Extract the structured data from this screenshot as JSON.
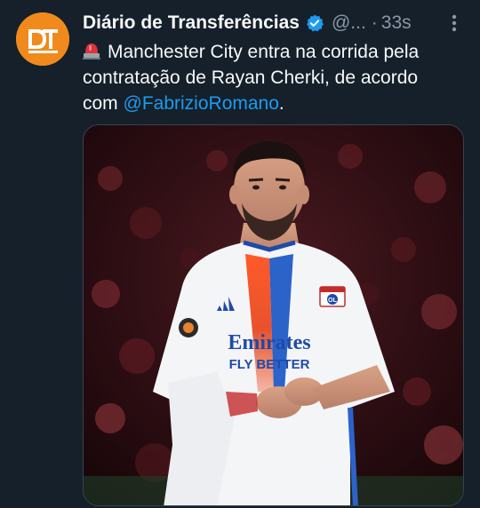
{
  "tweet": {
    "author_name": "Diário de Transferências",
    "handle": "@...",
    "separator": "·",
    "timestamp": "33s",
    "text_line1": "Manchester City entra na corrida pela",
    "text_line2": "contratação de Rayan Cherki, de acordo",
    "text_line3_prefix": "com ",
    "mention": "@FabrizioRomano",
    "text_line3_suffix": "."
  },
  "avatar": {
    "initials": "DT",
    "color": "#f08a1c"
  },
  "media": {
    "shirt_sponsor_line1": "Emirates",
    "shirt_sponsor_line2": "FLY BETTER",
    "badge_text": "OL"
  },
  "colors": {
    "background": "#15202b",
    "accent": "#1d9bf0",
    "secondary_text": "#8b98a5"
  },
  "icons": {
    "verified": "verified-badge-icon",
    "more": "more-options-icon",
    "siren": "police-siren-emoji"
  }
}
